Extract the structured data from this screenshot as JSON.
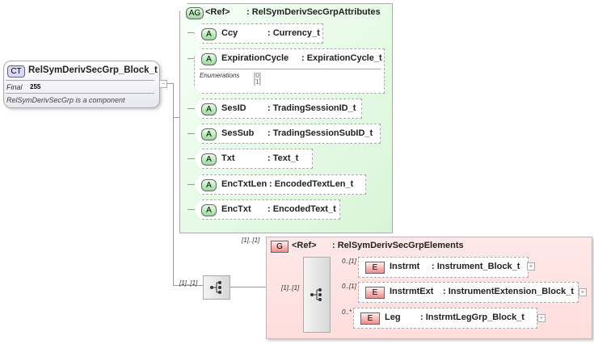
{
  "complex_type": {
    "badge": "CT",
    "name": "RelSymDerivSecGrp_Block_t",
    "final_label": "Final",
    "final_value": "255",
    "description": "RelSymDerivSecGrp is a component"
  },
  "attribute_group": {
    "badge": "AG",
    "ref": "<Ref>",
    "name": ": RelSymDerivSecGrpAttributes",
    "attributes": [
      {
        "badge": "A",
        "name": "Ccy",
        "type": ": Currency_t"
      },
      {
        "badge": "A",
        "name": "ExpirationCycle",
        "type": ": ExpirationCycle_t",
        "enum_label": "Enumerations",
        "enums": [
          "[0]",
          "[1]"
        ]
      },
      {
        "badge": "A",
        "name": "SesID",
        "type": ": TradingSessionID_t"
      },
      {
        "badge": "A",
        "name": "SesSub",
        "type": ": TradingSessionSubID_t"
      },
      {
        "badge": "A",
        "name": "Txt",
        "type": ": Text_t"
      },
      {
        "badge": "A",
        "name": "EncTxtLen",
        "type": ": EncodedTextLen_t"
      },
      {
        "badge": "A",
        "name": "EncTxt",
        "type": ": EncodedText_t"
      }
    ]
  },
  "outer_sequence": {
    "cardinality": "[1]..[1]"
  },
  "group": {
    "badge": "G",
    "ref": "<Ref>",
    "name": ": RelSymDerivSecGrpElements",
    "cardinality": "[1]..[1]",
    "sequence_cardinality": "[1]..[1]",
    "elements": [
      {
        "badge": "E",
        "name": "Instrmt",
        "type": ": Instrument_Block_t",
        "cardinality": "0..[1]"
      },
      {
        "badge": "E",
        "name": "InstrmtExt",
        "type": ": InstrumentExtension_Block_t",
        "cardinality": "0..[1]"
      },
      {
        "badge": "E",
        "name": "Leg",
        "type": ": InstrmtLegGrp_Block_t",
        "cardinality": "0..*"
      }
    ]
  }
}
